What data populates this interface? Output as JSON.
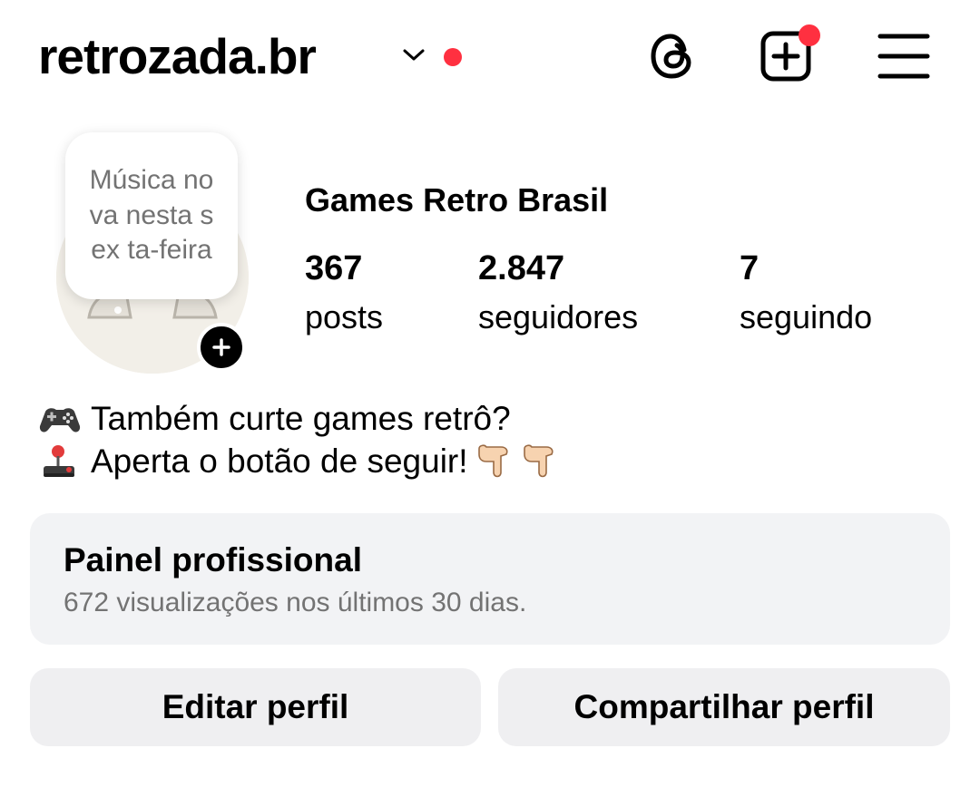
{
  "header": {
    "username": "retrozada.br",
    "icons": [
      "chevron-down-icon",
      "threads-icon",
      "create-post-icon",
      "menu-icon"
    ],
    "notification_dot_color": "#ff3040"
  },
  "profile": {
    "note": "Música nova nesta sex ta-feira",
    "display_name": "Games Retro Brasil",
    "stats": {
      "posts": {
        "value": "367",
        "label": "posts"
      },
      "followers": {
        "value": "2.847",
        "label": "seguidores"
      },
      "following": {
        "value": "7",
        "label": "seguindo"
      }
    }
  },
  "bio": {
    "line1": "Também curte games retrô?",
    "line2": "Aperta o botão de seguir!",
    "line1_emoji": "gamepad-emoji",
    "line2_emoji": "joystick-emoji",
    "trailing_emoji": "pointing-down-hand-emoji x2"
  },
  "dashboard": {
    "title": "Painel profissional",
    "subtitle": "672 visualizações nos últimos 30 dias."
  },
  "actions": {
    "edit": "Editar perfil",
    "share": "Compartilhar perfil"
  },
  "colors": {
    "background": "#ffffff",
    "text": "#000000",
    "secondary_text": "#737373",
    "card": "#f2f3f5",
    "accent_dot": "#ff3040"
  }
}
